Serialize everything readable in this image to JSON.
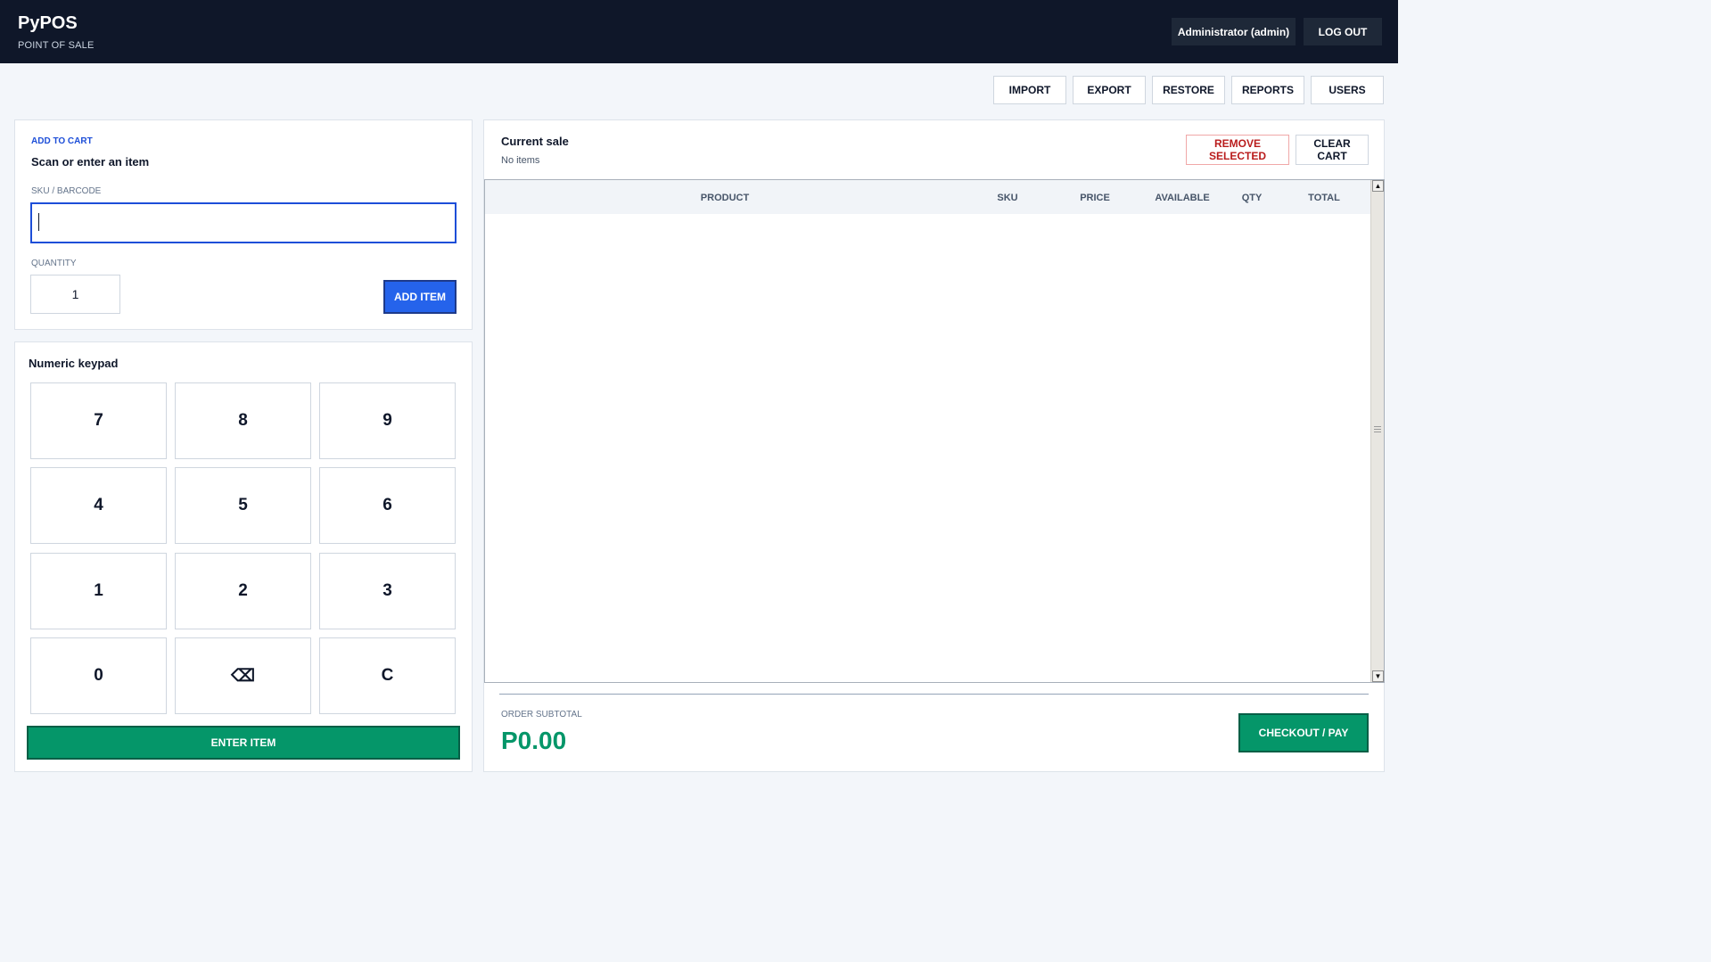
{
  "header": {
    "app_title": "PyPOS",
    "app_subtitle": "POINT OF SALE",
    "user_label": "Administrator (admin)",
    "logout_label": "LOG OUT"
  },
  "toolbar": {
    "items": [
      "IMPORT",
      "EXPORT",
      "RESTORE",
      "REPORTS",
      "USERS"
    ]
  },
  "add_to_cart": {
    "section_label": "ADD TO CART",
    "heading": "Scan or enter an item",
    "sku_label": "SKU / BARCODE",
    "sku_value": "",
    "quantity_label": "QUANTITY",
    "quantity_value": "1",
    "add_button": "ADD ITEM"
  },
  "keypad": {
    "heading": "Numeric keypad",
    "keys": [
      "7",
      "8",
      "9",
      "4",
      "5",
      "6",
      "1",
      "2",
      "3",
      "0",
      "⌫",
      "C"
    ],
    "enter_button": "ENTER ITEM"
  },
  "sale": {
    "title": "Current sale",
    "subtitle": "No items",
    "remove_button": "REMOVE SELECTED",
    "clear_button": "CLEAR CART",
    "columns": [
      "PRODUCT",
      "SKU",
      "PRICE",
      "AVAILABLE",
      "QTY",
      "TOTAL"
    ],
    "rows": [],
    "subtotal_label": "ORDER SUBTOTAL",
    "subtotal_value": "P0.00",
    "checkout_button": "CHECKOUT / PAY"
  },
  "colors": {
    "topbar": "#0f1729",
    "accent_blue": "#2563eb",
    "accent_green": "#059669",
    "danger_red": "#b91c1c"
  }
}
